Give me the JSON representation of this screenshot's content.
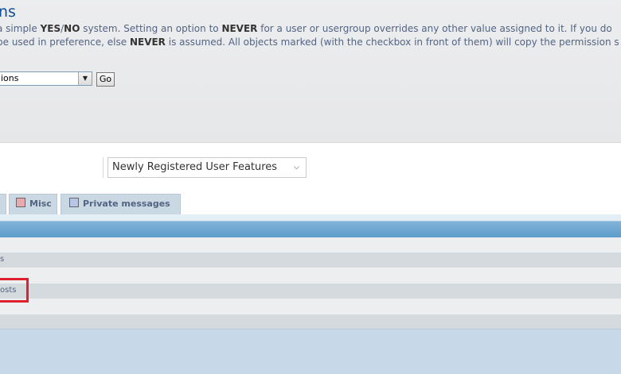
{
  "header": {
    "title": "ns",
    "desc_line1": [
      {
        "t": "a simple ",
        "b": false
      },
      {
        "t": "YES",
        "b": true
      },
      {
        "t": "/",
        "b": false
      },
      {
        "t": "NO",
        "b": true
      },
      {
        "t": " system. Setting an option to ",
        "b": false
      },
      {
        "t": "NEVER",
        "b": true
      },
      {
        "t": " for a user or usergroup overrides any other value assigned to it. If you do",
        "b": false
      }
    ],
    "desc_line2": [
      {
        "t": " be used in preference, else ",
        "b": false
      },
      {
        "t": "NEVER",
        "b": true
      },
      {
        "t": " is assumed. All objects marked (with the checkbox in front of them) will copy the permission s",
        "b": false
      }
    ]
  },
  "top_select": {
    "value": "ions",
    "go_label": "Go"
  },
  "role_select": {
    "value": "Newly Registered User Features"
  },
  "tabs": [
    {
      "label": "",
      "color": "#d8c7ad"
    },
    {
      "label": "Misc",
      "color": "#e9a9b1"
    },
    {
      "label": "Private messages",
      "color": "#b9c5e8"
    }
  ],
  "rows": [
    {
      "label": ""
    },
    {
      "label": "s"
    },
    {
      "label": ""
    },
    {
      "label": "osts"
    },
    {
      "label": ""
    },
    {
      "label": ""
    }
  ],
  "colors": {
    "accent": "#115098",
    "highlight": "#e0202f",
    "bar": "#5c9ccb"
  }
}
